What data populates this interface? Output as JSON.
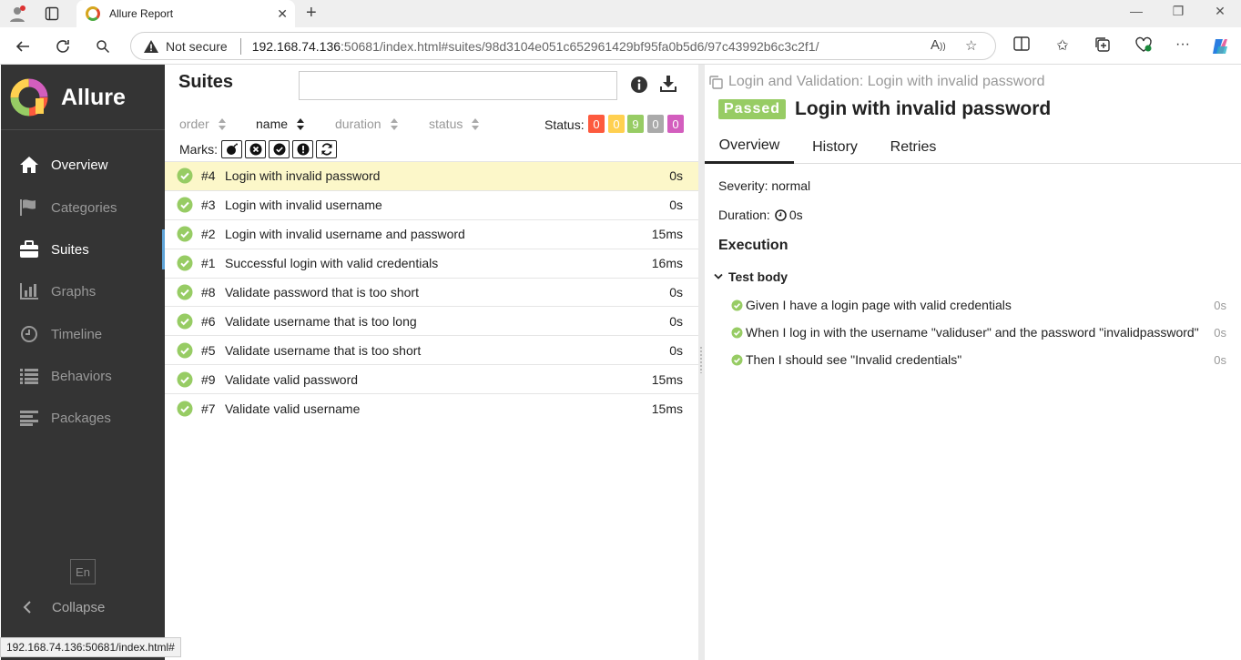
{
  "browser": {
    "tab_title": "Allure Report",
    "not_secure": "Not secure",
    "url_host": "192.168.74.136",
    "url_path": ":50681/index.html#suites/98d3104e051c652961429bf95fa0b5d6/97c43992b6c3c2f1/",
    "status_url": "192.168.74.136:50681/index.html#"
  },
  "sidebar": {
    "brand": "Allure",
    "items": [
      {
        "label": "Overview",
        "icon": "home-icon"
      },
      {
        "label": "Categories",
        "icon": "flag-icon"
      },
      {
        "label": "Suites",
        "icon": "briefcase-icon"
      },
      {
        "label": "Graphs",
        "icon": "bar-chart-icon"
      },
      {
        "label": "Timeline",
        "icon": "clock-icon"
      },
      {
        "label": "Behaviors",
        "icon": "list-icon"
      },
      {
        "label": "Packages",
        "icon": "align-left-icon"
      }
    ],
    "lang": "En",
    "collapse": "Collapse"
  },
  "suites": {
    "title": "Suites",
    "sort": {
      "order": "order",
      "name": "name",
      "duration": "duration",
      "status": "status"
    },
    "status_label": "Status:",
    "status_counts": [
      {
        "value": "0",
        "color": "#fd5a3e"
      },
      {
        "value": "0",
        "color": "#ffd050"
      },
      {
        "value": "9",
        "color": "#97cc64"
      },
      {
        "value": "0",
        "color": "#aaaaaa"
      },
      {
        "value": "0",
        "color": "#d35ebe"
      }
    ],
    "marks_label": "Marks:",
    "tests": [
      {
        "num": "#4",
        "name": "Login with invalid password",
        "dur": "0s"
      },
      {
        "num": "#3",
        "name": "Login with invalid username",
        "dur": "0s"
      },
      {
        "num": "#2",
        "name": "Login with invalid username and password",
        "dur": "15ms"
      },
      {
        "num": "#1",
        "name": "Successful login with valid credentials",
        "dur": "16ms"
      },
      {
        "num": "#8",
        "name": "Validate password that is too short",
        "dur": "0s"
      },
      {
        "num": "#6",
        "name": "Validate username that is too long",
        "dur": "0s"
      },
      {
        "num": "#5",
        "name": "Validate username that is too short",
        "dur": "0s"
      },
      {
        "num": "#9",
        "name": "Validate valid password",
        "dur": "15ms"
      },
      {
        "num": "#7",
        "name": "Validate valid username",
        "dur": "15ms"
      }
    ]
  },
  "details": {
    "breadcrumb": "Login and Validation: Login with invalid password",
    "status": "Passed",
    "title": "Login with invalid password",
    "tabs": [
      "Overview",
      "History",
      "Retries"
    ],
    "severity": "Severity: normal",
    "duration_label": "Duration:",
    "duration_value": "0s",
    "execution": "Execution",
    "test_body": "Test body",
    "steps": [
      {
        "text": "Given I have a login page with valid credentials",
        "dur": "0s"
      },
      {
        "text": "When I log in with the username \"validuser\" and the password \"invalidpassword\"",
        "dur": "0s"
      },
      {
        "text": "Then I should see \"Invalid credentials\"",
        "dur": "0s"
      }
    ]
  }
}
